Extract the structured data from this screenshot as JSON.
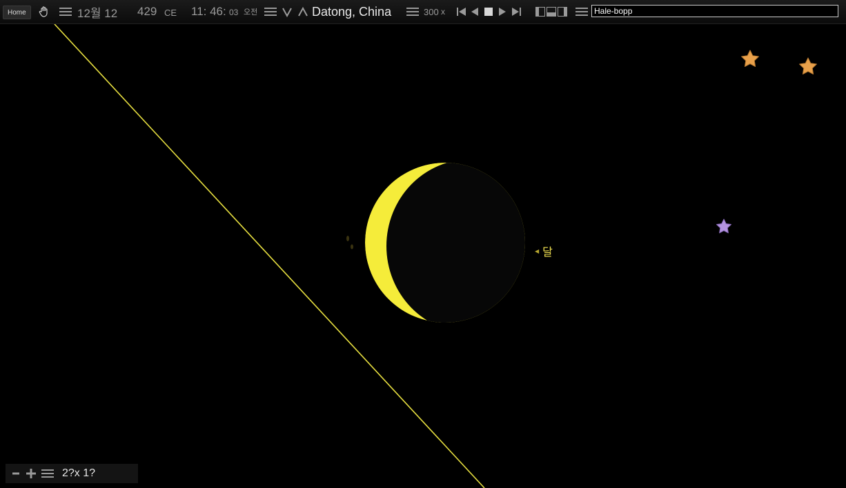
{
  "toolbar": {
    "home_label": "Home",
    "month_day": "12월 12",
    "year": "429",
    "era": "CE",
    "time_hm": "11: 46:",
    "time_sec": "03",
    "ampm": "오전",
    "location": "Datong, China",
    "speed_value": "300",
    "speed_unit": "x",
    "search_value": "Hale-bopp"
  },
  "sky": {
    "moon_label": "달",
    "colors": {
      "moon": "#f5ec3a",
      "horizon_line": "#e8e040",
      "star_orange": "#e8a04a",
      "star_purple": "#b493e0"
    }
  },
  "zoom": {
    "fov_text": "2?x 1?"
  },
  "icons": [
    "hand-pan-icon",
    "menu-icon",
    "chevron-down-icon",
    "chevron-up-icon",
    "skip-start-icon",
    "step-back-icon",
    "stop-icon",
    "play-icon",
    "skip-end-icon",
    "layout-left-icon",
    "layout-bottom-icon",
    "layout-right-icon",
    "minus-icon",
    "plus-icon"
  ]
}
